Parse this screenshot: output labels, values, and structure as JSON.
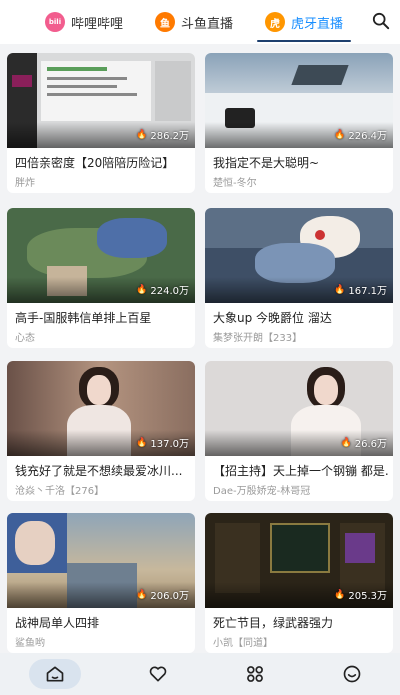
{
  "tabs": [
    {
      "label": "哔哩哔哩",
      "logo_text": "bili",
      "color": "#f25d8e"
    },
    {
      "label": "斗鱼直播",
      "logo_text": "鱼",
      "color": "#ff7a00"
    },
    {
      "label": "虎牙直播",
      "logo_text": "虎",
      "color": "#ff9600"
    }
  ],
  "search_icon": "search-icon",
  "cards": [
    {
      "title": "四倍亲密度【20陪陪历险记】",
      "author": "胖炸",
      "viewers": "286.2万"
    },
    {
      "title": "我指定不是大聪明~",
      "author": "楚恒-冬尔",
      "viewers": "226.4万"
    },
    {
      "title": "高手-国服韩信单排上百星",
      "author": "心态",
      "viewers": "224.0万"
    },
    {
      "title": "大象up 今晚爵位 溜达",
      "author": "集梦张开朗【233】",
      "viewers": "167.1万"
    },
    {
      "title": "钱充好了就是不想续最爱冰川...",
      "author": "沧焱丶千洛【276】",
      "viewers": "137.0万"
    },
    {
      "title": "【招主持】天上掉一个钢镚 都是...",
      "author": "Dae-万殷娇宠-林哥冠",
      "viewers": "26.6万"
    },
    {
      "title": "战神局单人四排",
      "author": "鲨鱼哟",
      "viewers": "206.0万"
    },
    {
      "title": "死亡节目，绿武器强力",
      "author": "小凯【同道】",
      "viewers": "205.3万"
    }
  ],
  "bottom_nav": [
    "home-icon",
    "heart-icon",
    "grid-icon",
    "smile-icon"
  ],
  "colors": {
    "accent": "#1a8fff",
    "tab_underline": "#1d3f6e",
    "bottom_bg": "#eef1f4"
  }
}
